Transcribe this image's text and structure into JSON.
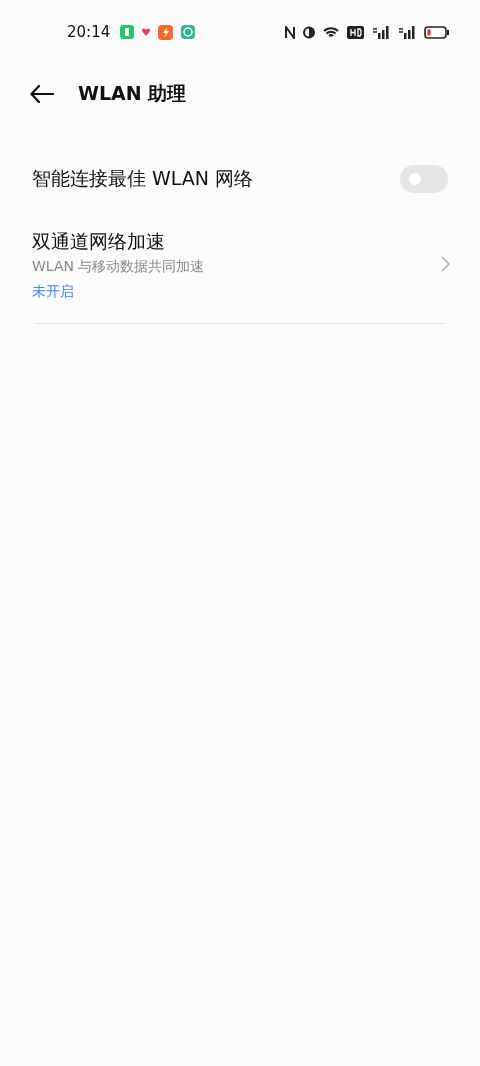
{
  "status_bar": {
    "time": "20:14"
  },
  "header": {
    "title": "WLAN 助理"
  },
  "settings": [
    {
      "kind": "switch",
      "label": "智能连接最佳 WLAN 网络",
      "on": false
    },
    {
      "kind": "link",
      "label": "双通道网络加速",
      "description": "WLAN 与移动数据共同加速",
      "status": "未开启"
    }
  ]
}
